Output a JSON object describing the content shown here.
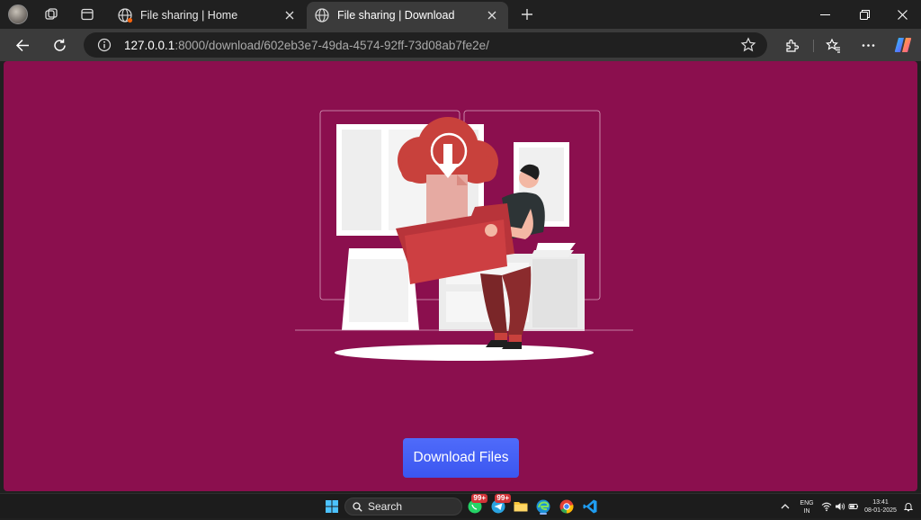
{
  "browser": {
    "tabs": [
      {
        "title": "File sharing | Home",
        "active": false
      },
      {
        "title": "File sharing | Download",
        "active": true
      }
    ],
    "address": {
      "host": "127.0.0.1",
      "rest": ":8000/download/602eb3e7-49da-4574-92ff-73d08ab7fe2e/"
    }
  },
  "page": {
    "background": "#8b0f4e",
    "download_button": "Download Files",
    "button_color": "#4560f5"
  },
  "taskbar": {
    "search_label": "Search",
    "badges": [
      "99+",
      "99+"
    ],
    "language": "ENG",
    "region": "IN",
    "time": "13:41",
    "date": "08-01-2025"
  }
}
